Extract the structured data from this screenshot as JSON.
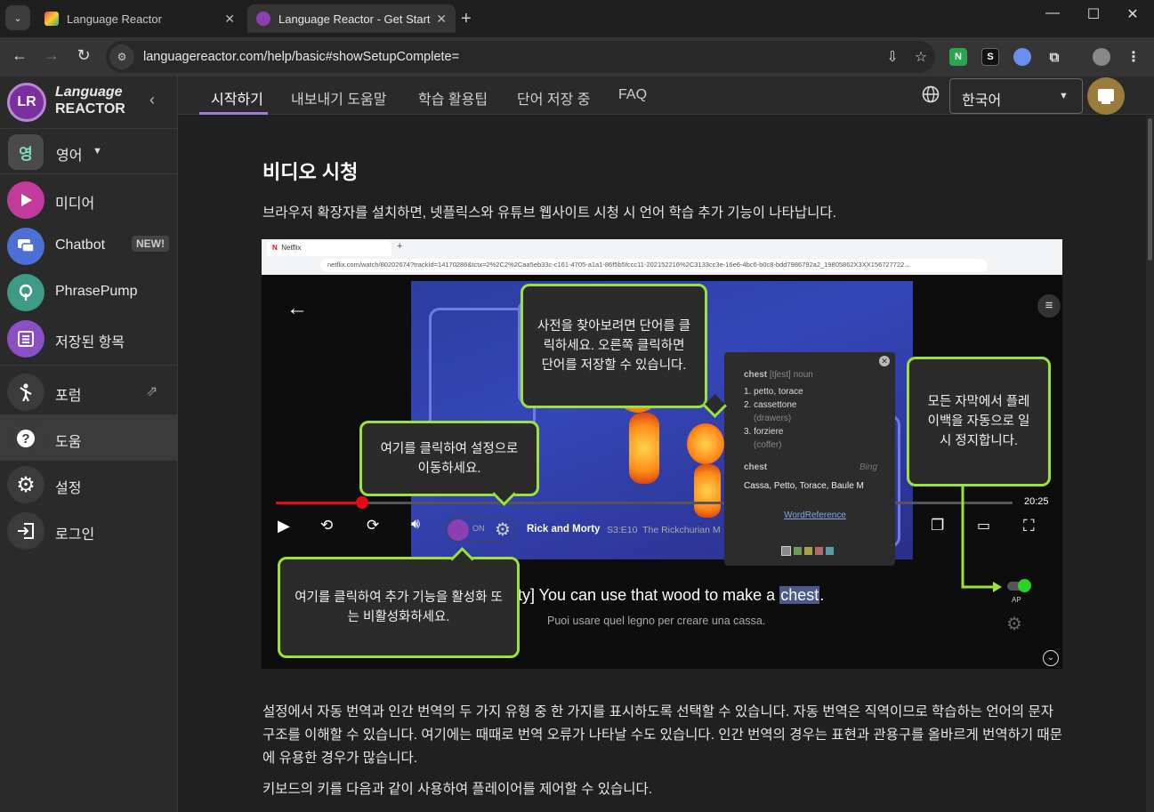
{
  "browser": {
    "tabs": [
      {
        "title": "Language Reactor",
        "active": false
      },
      {
        "title": "Language Reactor - Get Starte",
        "active": true
      }
    ],
    "url": "languagereactor.com/help/basic#showSetupComplete="
  },
  "sidebar": {
    "brand": {
      "line1": "Language",
      "line2": "REACTOR"
    },
    "language": {
      "badge": "영",
      "label": "영어"
    },
    "items": [
      {
        "label": "미디어",
        "color": "#c23b9c"
      },
      {
        "label": "Chatbot",
        "badge": "NEW!",
        "color": "#4c6fd6"
      },
      {
        "label": "PhrasePump",
        "color": "#3c9a86"
      },
      {
        "label": "저장된 항목",
        "color": "#8a4fc2"
      },
      {
        "label": "포럼"
      },
      {
        "label": "도움",
        "selected": true
      },
      {
        "label": "설정"
      },
      {
        "label": "로그인"
      }
    ]
  },
  "pagenav": {
    "tabs": [
      "시작하기",
      "내보내기 도움말",
      "학습 활용팁",
      "단어 저장 중",
      "FAQ"
    ],
    "active_tab": "시작하기",
    "ui_language": "한국어"
  },
  "content": {
    "title": "비디오 시청",
    "intro": "브라우저 확장자를 설치하면, 넷플릭스와 유튜브 웹사이트 시청 시 언어 학습 추가 기능이 나타납니다.",
    "para1": "설정에서 자동 번역과 인간 번역의 두 가지 유형 중 한 가지를 표시하도록 선택할 수 있습니다. 자동 번역은 직역이므로 학습하는 언어의 문자 구조를 이해할 수 있습니다. 여기에는 때때로 번역 오류가 나타날 수도 있습니다. 인간 번역의 경우는 표현과 관용구를 올바르게 번역하기 때문에 유용한 경우가 많습니다.",
    "para2": "키보드의 키를 다음과 같이 사용하여 플레이어를 제어할 수 있습니다."
  },
  "screenshot": {
    "tab_title": "Netflix",
    "url": "netflix.com/watch/80202674?trackId=14170286&tctx=2%2C2%2Caa5eb33c-c161-4705-a1a1-86f5b5fccc11-202152216%2C3133cc3e-16e6-4bc6-b0c8-bdd7986792a2_19805862X3XX156727722...",
    "time_left": "20:25",
    "show_title": "Rick and Morty",
    "episode": "S3:E10  The Rickchurian M",
    "lr_toggle": "ON",
    "subtitle_en_prefix": "rty] You can use that wood to make a ",
    "subtitle_en_word": "chest",
    "subtitle_en_suffix": ".",
    "subtitle_it": "Puoi usare quel legno per creare una cassa.",
    "ap_label": "AP",
    "dictionary": {
      "headword": "chest",
      "ipa": "[tʃest]",
      "pos": "noun",
      "senses": [
        {
          "n": "1.",
          "text": "petto, torace",
          "note": ""
        },
        {
          "n": "2.",
          "text": "cassettone",
          "note": "(drawers)"
        },
        {
          "n": "3.",
          "text": "forziere",
          "note": "(coffer)"
        }
      ],
      "mt_word": "chest",
      "mt_source": "Bing",
      "mt_text": "Cassa, Petto, Torace, Baule M",
      "link": "WordReference"
    },
    "callouts": [
      "사전을 찾아보려면 단어를 클릭하세요. 오른쪽 클릭하면 단어를 저장할 수 있습니다.",
      "여기를 클릭하여 설정으로 이동하세요.",
      "여기를 클릭하여 추가 기능을 활성화 또는 비활성화하세요.",
      "모든 자막에서 플레이백을 자동으로 일시 정지합니다."
    ]
  }
}
